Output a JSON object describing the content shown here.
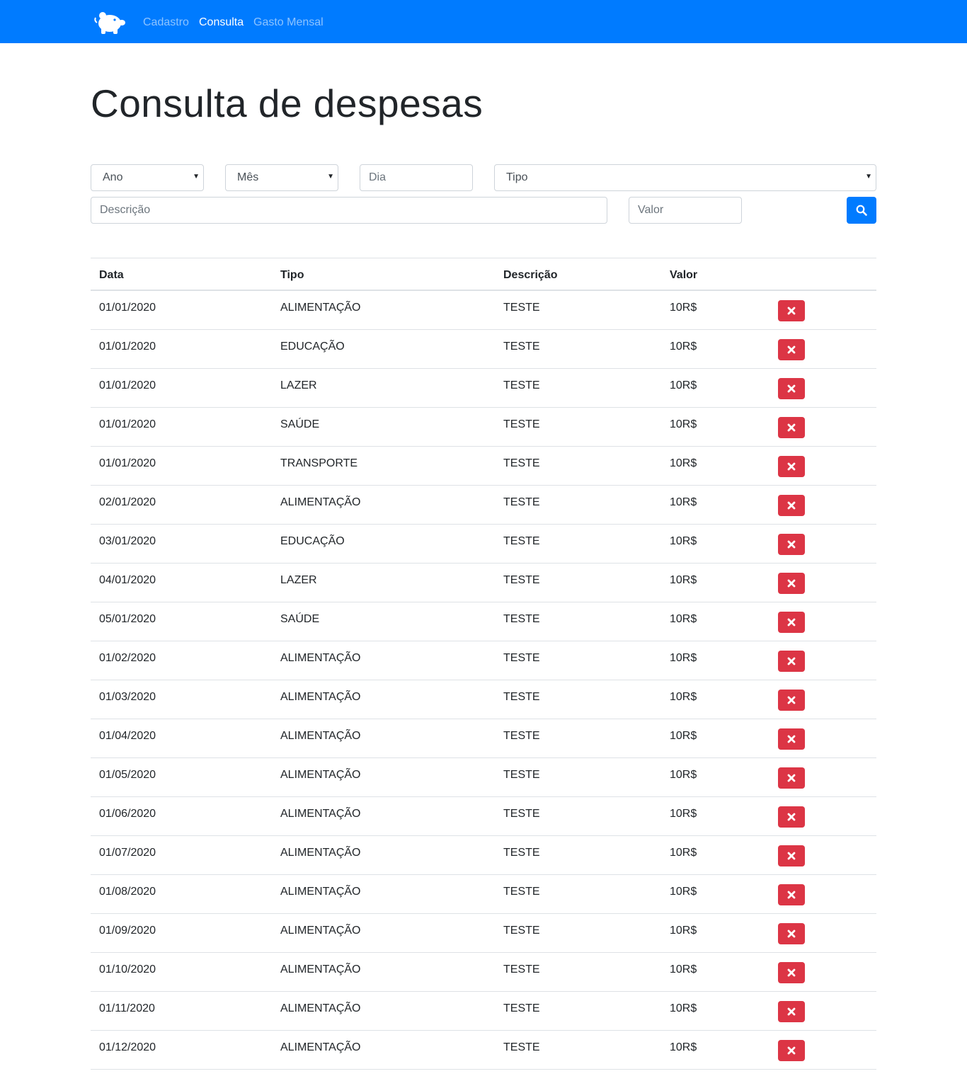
{
  "navbar": {
    "brand_icon": "piggy-bank-icon",
    "links": [
      {
        "label": "Cadastro",
        "active": false
      },
      {
        "label": "Consulta",
        "active": true
      },
      {
        "label": "Gasto Mensal",
        "active": false
      }
    ],
    "background": "#007bff"
  },
  "page": {
    "title": "Consulta de despesas"
  },
  "filters": {
    "ano": "Ano",
    "mes": "Mês",
    "dia_placeholder": "Dia",
    "tipo": "Tipo",
    "descricao_placeholder": "Descrição",
    "valor_placeholder": "Valor",
    "search_icon": "search-icon"
  },
  "table": {
    "headers": [
      "Data",
      "Tipo",
      "Descrição",
      "Valor"
    ],
    "delete_icon": "close-icon",
    "delete_color": "#dc3545",
    "rows": [
      [
        "01/01/2020",
        "ALIMENTAÇÃO",
        "TESTE",
        "10R$"
      ],
      [
        "01/01/2020",
        "EDUCAÇÃO",
        "TESTE",
        "10R$"
      ],
      [
        "01/01/2020",
        "LAZER",
        "TESTE",
        "10R$"
      ],
      [
        "01/01/2020",
        "SAÚDE",
        "TESTE",
        "10R$"
      ],
      [
        "01/01/2020",
        "TRANSPORTE",
        "TESTE",
        "10R$"
      ],
      [
        "02/01/2020",
        "ALIMENTAÇÃO",
        "TESTE",
        "10R$"
      ],
      [
        "03/01/2020",
        "EDUCAÇÃO",
        "TESTE",
        "10R$"
      ],
      [
        "04/01/2020",
        "LAZER",
        "TESTE",
        "10R$"
      ],
      [
        "05/01/2020",
        "SAÚDE",
        "TESTE",
        "10R$"
      ],
      [
        "01/02/2020",
        "ALIMENTAÇÃO",
        "TESTE",
        "10R$"
      ],
      [
        "01/03/2020",
        "ALIMENTAÇÃO",
        "TESTE",
        "10R$"
      ],
      [
        "01/04/2020",
        "ALIMENTAÇÃO",
        "TESTE",
        "10R$"
      ],
      [
        "01/05/2020",
        "ALIMENTAÇÃO",
        "TESTE",
        "10R$"
      ],
      [
        "01/06/2020",
        "ALIMENTAÇÃO",
        "TESTE",
        "10R$"
      ],
      [
        "01/07/2020",
        "ALIMENTAÇÃO",
        "TESTE",
        "10R$"
      ],
      [
        "01/08/2020",
        "ALIMENTAÇÃO",
        "TESTE",
        "10R$"
      ],
      [
        "01/09/2020",
        "ALIMENTAÇÃO",
        "TESTE",
        "10R$"
      ],
      [
        "01/10/2020",
        "ALIMENTAÇÃO",
        "TESTE",
        "10R$"
      ],
      [
        "01/11/2020",
        "ALIMENTAÇÃO",
        "TESTE",
        "10R$"
      ],
      [
        "01/12/2020",
        "ALIMENTAÇÃO",
        "TESTE",
        "10R$"
      ]
    ]
  }
}
